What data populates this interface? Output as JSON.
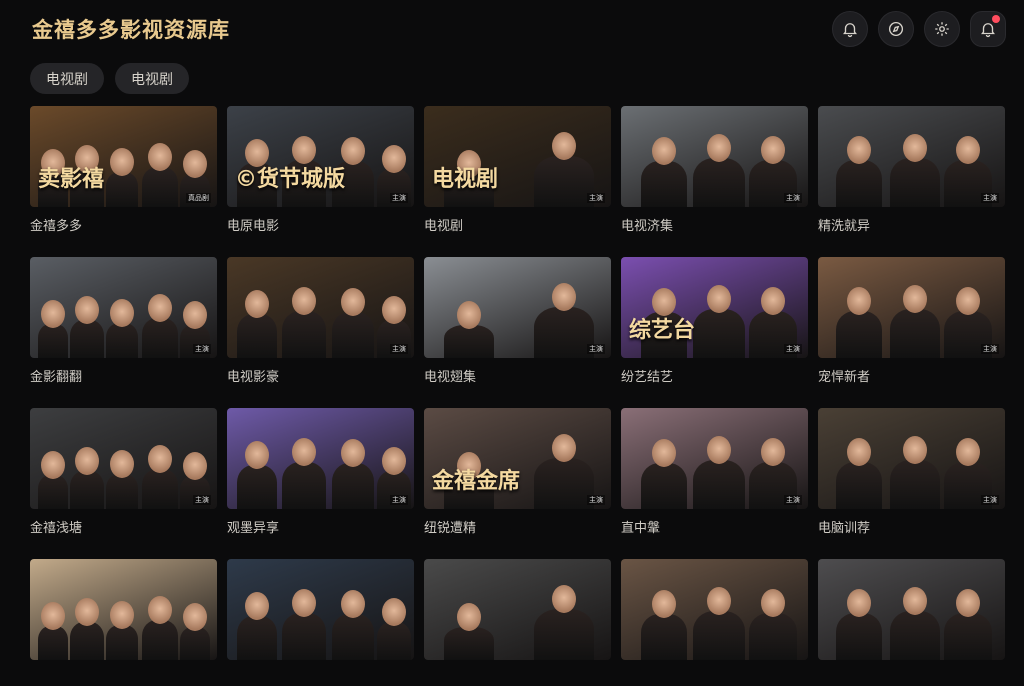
{
  "app": {
    "title": "金禧多多影视资源库"
  },
  "chips": [
    "电视剧",
    "电视剧"
  ],
  "icons": [
    "bell-icon",
    "compass-icon",
    "gear-icon",
    "notification-icon"
  ],
  "cards": [
    {
      "label": "金禧多多",
      "overlay": "卖影禧",
      "tag": "真品剧",
      "bg": "#6b4a2a"
    },
    {
      "label": "电原电影",
      "overlay": "©货节城版",
      "tag": "主演",
      "bg": "#3c4148"
    },
    {
      "label": "电视剧",
      "overlay": "电视剧",
      "tag": "主演",
      "bg": "#3b2d1d"
    },
    {
      "label": "电视济集",
      "overlay": "",
      "tag": "主演",
      "bg": "#6b6f73"
    },
    {
      "label": "精洗就异",
      "overlay": "",
      "tag": "主演",
      "bg": "#4a4c4f"
    },
    {
      "label": "金影翻翻",
      "overlay": "",
      "tag": "主演",
      "bg": "#5a5e64"
    },
    {
      "label": "电视影豪",
      "overlay": "",
      "tag": "主演",
      "bg": "#4a3826"
    },
    {
      "label": "电视翅集",
      "overlay": "",
      "tag": "主演",
      "bg": "#8a8e93"
    },
    {
      "label": "纷艺结艺",
      "overlay": "综艺台",
      "tag": "主演",
      "bg": "#7b4fb0"
    },
    {
      "label": "宠悍新者",
      "overlay": "",
      "tag": "主演",
      "bg": "#7a5a42"
    },
    {
      "label": "金禧浅塘",
      "overlay": "",
      "tag": "主演",
      "bg": "#3d3e40"
    },
    {
      "label": "观墨异享",
      "overlay": "",
      "tag": "主演",
      "bg": "#6e5aa8"
    },
    {
      "label": "纽锐遭精",
      "overlay": "金禧金席",
      "tag": "主演",
      "bg": "#5b4b44"
    },
    {
      "label": "直中鞶",
      "overlay": "",
      "tag": "主演",
      "bg": "#8a6f77"
    },
    {
      "label": "电脑训荐",
      "overlay": "",
      "tag": "主演",
      "bg": "#4a4035"
    },
    {
      "label": "",
      "overlay": "",
      "tag": "",
      "bg": "#c2aa8a"
    },
    {
      "label": "",
      "overlay": "",
      "tag": "",
      "bg": "#2e3a4a"
    },
    {
      "label": "",
      "overlay": "",
      "tag": "",
      "bg": "#4a4a4a"
    },
    {
      "label": "",
      "overlay": "",
      "tag": "",
      "bg": "#6a5545"
    },
    {
      "label": "",
      "overlay": "",
      "tag": "",
      "bg": "#4e4d4f"
    }
  ]
}
